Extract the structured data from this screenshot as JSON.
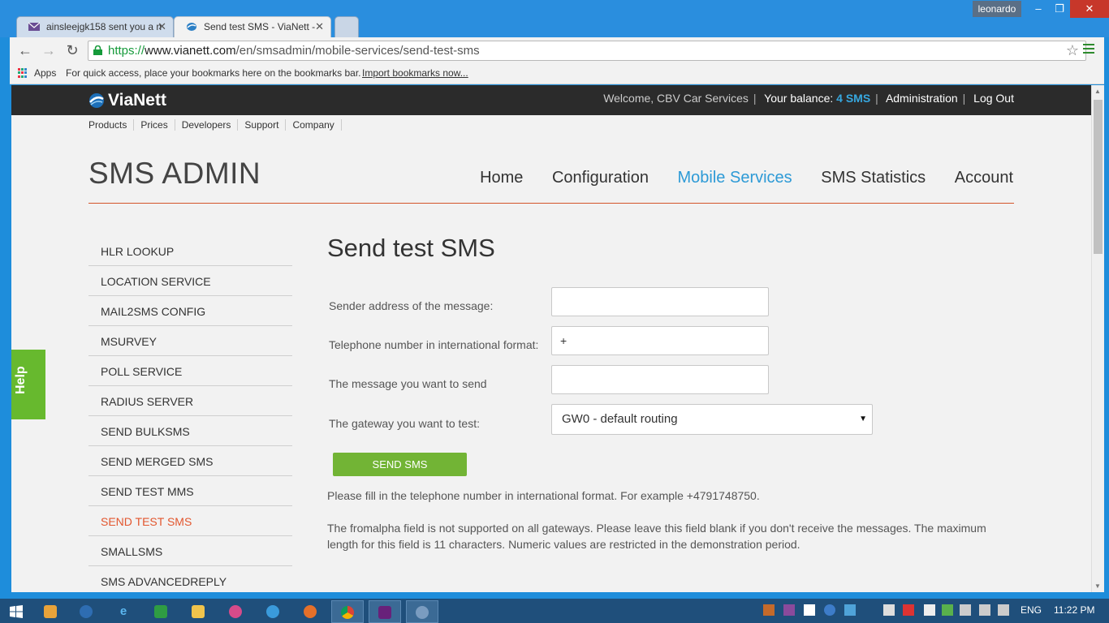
{
  "window": {
    "user": "leonardo",
    "min_label": "–",
    "max_label": "❐",
    "close_label": "✕"
  },
  "tabs": [
    {
      "label": "ainsleejgk158 sent you a n",
      "close": "✕"
    },
    {
      "label": "Send test SMS - ViaNett -",
      "close": "✕"
    }
  ],
  "toolbar": {
    "url_https": "https://",
    "url_host": "www.vianett.com",
    "url_path": "/en/smsadmin/mobile-services/send-test-sms",
    "back": "←",
    "forward": "→",
    "reload": "↻",
    "star": "☆"
  },
  "bookmarks": {
    "apps": "Apps",
    "message": "For quick access, place your bookmarks here on the bookmarks bar.",
    "import": "Import bookmarks now..."
  },
  "site": {
    "logo": "ViaNett",
    "welcome": "Welcome, CBV Car Services",
    "balance_label": "Your balance:",
    "balance_value": "4 SMS",
    "administration": "Administration",
    "logout": "Log Out",
    "subnav": [
      "Products",
      "Prices",
      "Developers",
      "Support",
      "Company"
    ],
    "admin_title": "SMS ADMIN",
    "mainnav": [
      "Home",
      "Configuration",
      "Mobile Services",
      "SMS Statistics",
      "Account"
    ],
    "mainnav_active": "Mobile Services",
    "accent_color": "#2d9ad6",
    "rule_color": "#d4552b"
  },
  "sidemenu": {
    "items": [
      "HLR LOOKUP",
      "LOCATION SERVICE",
      "MAIL2SMS CONFIG",
      "MSURVEY",
      "POLL SERVICE",
      "RADIUS SERVER",
      "SEND BULKSMS",
      "SEND MERGED SMS",
      "SEND TEST MMS",
      "SEND TEST SMS",
      "SMALLSMS",
      "SMS ADVANCEDREPLY"
    ],
    "active": "SEND TEST SMS"
  },
  "help": {
    "label": "Help"
  },
  "form": {
    "title": "Send test SMS",
    "sender_label": "Sender address of the message:",
    "sender_value": "",
    "phone_label": "Telephone number in international format:",
    "phone_value": "+",
    "message_label": "The message you want to send",
    "message_value": "",
    "gateway_label": "The gateway you want to test:",
    "gateway_value": "GW0 - default routing",
    "submit": "SEND SMS",
    "hint1": "Please fill in the telephone number in international format. For example +4791748750.",
    "hint2": "The fromalpha field is not supported on all gateways. Please leave this field blank if you don't receive the messages. The maximum length for this field is 11 characters. Numeric values are restricted in the demonstration period."
  },
  "taskbar": {
    "lang": "ENG",
    "time": "11:22 PM"
  }
}
